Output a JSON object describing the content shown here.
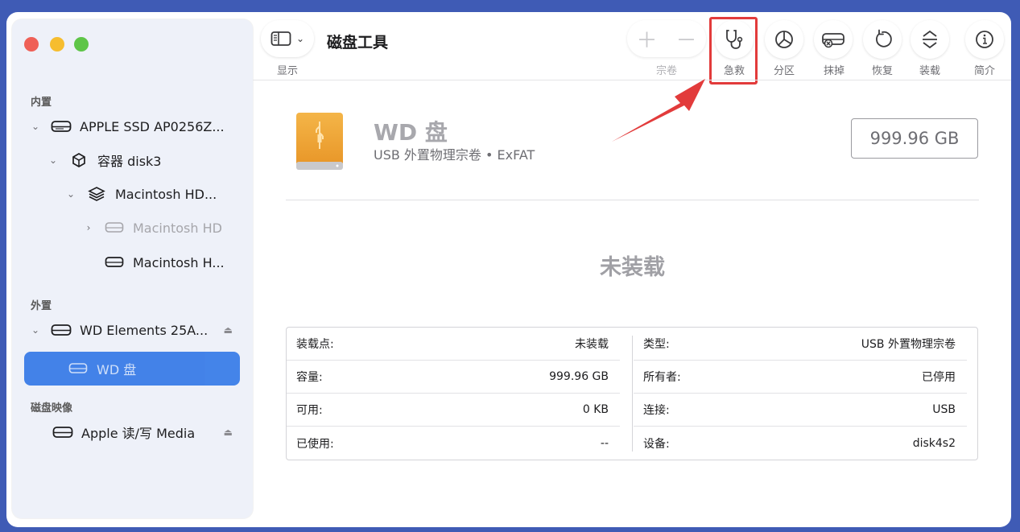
{
  "window": {
    "title": "磁盘工具"
  },
  "sidebar": {
    "sections": {
      "internal": "内置",
      "external": "外置",
      "disk_images": "磁盘映像"
    },
    "items": [
      {
        "label": "APPLE SSD AP0256Z...",
        "icon": "internal-disk-icon",
        "expanded": true
      },
      {
        "label": "容器 disk3",
        "icon": "container-cube-icon",
        "expanded": true
      },
      {
        "label": "Macintosh HD...",
        "icon": "volume-layers-icon",
        "expanded": true
      },
      {
        "label": "Macintosh HD",
        "icon": "disk-icon",
        "dimmed": true
      },
      {
        "label": "Macintosh H...",
        "icon": "disk-icon"
      },
      {
        "label": "WD Elements 25A...",
        "icon": "external-disk-icon",
        "expanded": true,
        "eject": true
      },
      {
        "label": "WD 盘",
        "icon": "disk-icon",
        "selected": true
      },
      {
        "label": "Apple 读/写 Media",
        "icon": "disk-image-icon",
        "eject": true
      }
    ]
  },
  "toolbar": {
    "view_label": "显示",
    "volume_label": "宗卷",
    "buttons": [
      {
        "label": "急救",
        "icon": "stethoscope-icon",
        "highlighted": true
      },
      {
        "label": "分区",
        "icon": "pie-chart-icon"
      },
      {
        "label": "抹掉",
        "icon": "erase-disk-icon"
      },
      {
        "label": "恢复",
        "icon": "restore-icon"
      },
      {
        "label": "装载",
        "icon": "mount-icon"
      },
      {
        "label": "简介",
        "icon": "info-icon"
      }
    ]
  },
  "disk": {
    "name": "WD 盘",
    "subtitle": "USB 外置物理宗卷 • ExFAT",
    "capacity": "999.96 GB",
    "status": "未装载"
  },
  "info": {
    "left": [
      {
        "key": "装载点:",
        "value": "未装载"
      },
      {
        "key": "容量:",
        "value": "999.96 GB"
      },
      {
        "key": "可用:",
        "value": "0 KB"
      },
      {
        "key": "已使用:",
        "value": "--"
      }
    ],
    "right": [
      {
        "key": "类型:",
        "value": "USB 外置物理宗卷"
      },
      {
        "key": "所有者:",
        "value": "已停用"
      },
      {
        "key": "连接:",
        "value": "USB"
      },
      {
        "key": "设备:",
        "value": "disk4s2"
      }
    ]
  },
  "colors": {
    "background": "#3f5bb5",
    "selection": "#3a7de8",
    "annotation": "#e23b3b",
    "disk_orange": "#f0a63a"
  }
}
